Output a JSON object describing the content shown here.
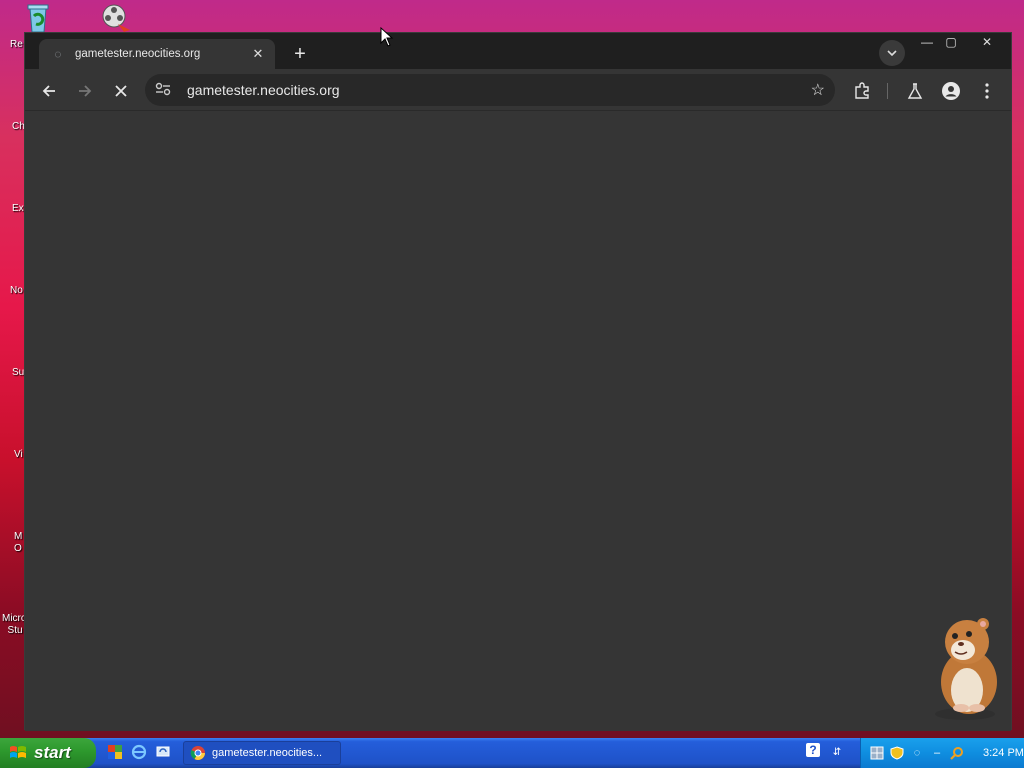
{
  "desktop": {
    "icons": [
      {
        "name": "recycle-bin",
        "label": "Re"
      },
      {
        "name": "movie-maker",
        "label": ""
      }
    ],
    "side_labels": [
      "Ch",
      "Ex",
      "No",
      "Su",
      "Vi",
      "M\nO",
      "Micro\nStu"
    ]
  },
  "browser": {
    "tab": {
      "title": "gametester.neocities.org"
    },
    "new_tab_symbol": "+",
    "omnibox": {
      "url": "gametester.neocities.org"
    },
    "window_controls": {
      "minimize": "—",
      "maximize": "▢",
      "close": "✕"
    }
  },
  "taskbar": {
    "start_label": "start",
    "task_item": "gametester.neocities...",
    "clock": "3:24 PM"
  },
  "colors": {
    "browser_bg": "#353535",
    "taskbar_blue": "#245edb",
    "start_green": "#2e9a2e"
  }
}
